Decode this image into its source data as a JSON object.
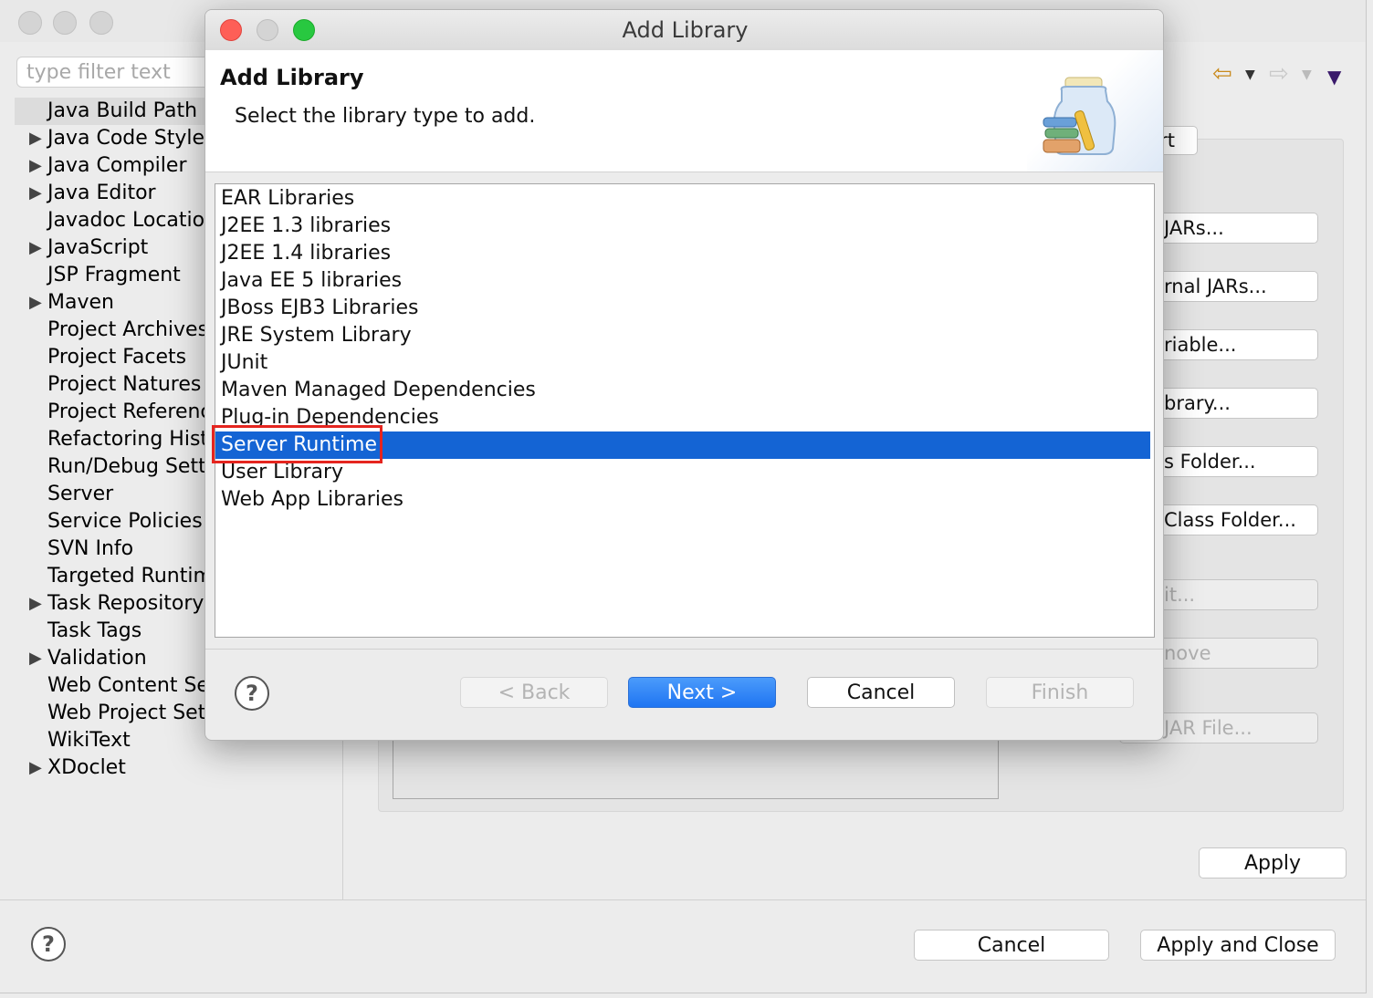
{
  "background_window": {
    "filter_placeholder": "type filter text",
    "tree_items": [
      {
        "label": "Java Build Path",
        "expandable": false,
        "selected": true
      },
      {
        "label": "Java Code Style",
        "expandable": true
      },
      {
        "label": "Java Compiler",
        "expandable": true
      },
      {
        "label": "Java Editor",
        "expandable": true
      },
      {
        "label": "Javadoc Location",
        "expandable": false
      },
      {
        "label": "JavaScript",
        "expandable": true
      },
      {
        "label": "JSP Fragment",
        "expandable": false
      },
      {
        "label": "Maven",
        "expandable": true
      },
      {
        "label": "Project Archives",
        "expandable": false
      },
      {
        "label": "Project Facets",
        "expandable": false
      },
      {
        "label": "Project Natures",
        "expandable": false
      },
      {
        "label": "Project References",
        "expandable": false
      },
      {
        "label": "Refactoring History",
        "expandable": false
      },
      {
        "label": "Run/Debug Settings",
        "expandable": false
      },
      {
        "label": "Server",
        "expandable": false
      },
      {
        "label": "Service Policies",
        "expandable": false
      },
      {
        "label": "SVN Info",
        "expandable": false
      },
      {
        "label": "Targeted Runtimes",
        "expandable": false
      },
      {
        "label": "Task Repository",
        "expandable": true
      },
      {
        "label": "Task Tags",
        "expandable": false
      },
      {
        "label": "Validation",
        "expandable": true
      },
      {
        "label": "Web Content Settings",
        "expandable": false
      },
      {
        "label": "Web Project Settings",
        "expandable": false
      },
      {
        "label": "WikiText",
        "expandable": false
      },
      {
        "label": "XDoclet",
        "expandable": true
      }
    ],
    "side_buttons": {
      "tab_partial": "rt",
      "add_jars": "JARs...",
      "add_external_jars": "rnal JARs...",
      "add_variable": "riable...",
      "add_library": "brary...",
      "add_class_folder": "s Folder...",
      "add_external_class_folder": "Class Folder...",
      "edit": "it...",
      "remove": "nove",
      "migrate_jar": "JAR File..."
    },
    "nav_icons": [
      "back-arrow-icon",
      "forward-arrow-icon",
      "view-menu-icon"
    ],
    "apply_label": "Apply",
    "cancel_label": "Cancel",
    "apply_close_label": "Apply and Close",
    "help_icon": "?"
  },
  "dialog": {
    "window_title": "Add Library",
    "banner_title": "Add Library",
    "banner_description": "Select the library type to add.",
    "banner_icon": "library-jar-icon",
    "libraries": [
      "EAR Libraries",
      "J2EE 1.3 libraries",
      "J2EE 1.4 libraries",
      "Java EE 5 libraries",
      "JBoss EJB3 Libraries",
      "JRE System Library",
      "JUnit",
      "Maven Managed Dependencies",
      "Plug-in Dependencies",
      "Server Runtime",
      "User Library",
      "Web App Libraries"
    ],
    "selected_library": "Server Runtime",
    "help_icon": "?",
    "buttons": {
      "back": "< Back",
      "next": "Next >",
      "cancel": "Cancel",
      "finish": "Finish"
    },
    "colors": {
      "selection": "#1464d4",
      "highlight_box": "#e5251f",
      "primary_button": "#1f75f2"
    }
  }
}
